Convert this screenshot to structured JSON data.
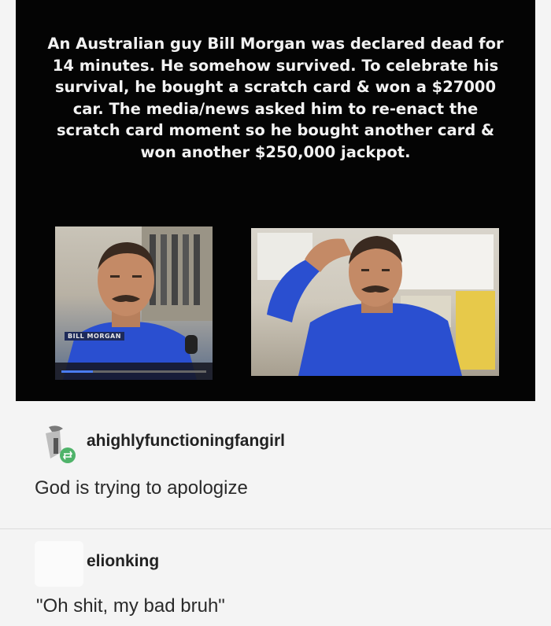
{
  "meme": {
    "caption": "An Australian guy Bill Morgan was declared dead for 14 minutes. He somehow survived. To celebrate his survival, he bought a scratch card & won a $27000 car. The media/news asked him to re-enact the scratch card moment so he bought another card & won another $250,000 jackpot.",
    "left_photo": {
      "lower_third": "BILL MORGAN",
      "video_progress": 0.22
    },
    "colors": {
      "shirt": "#2a4fd0",
      "background": "#040404"
    }
  },
  "post": {
    "reblogs": [
      {
        "username": "ahighlyfunctioningfangirl",
        "comment": "God is trying to apologize",
        "avatar_icon": "reblog-avatar-icon"
      },
      {
        "username": "elionking",
        "comment": "\"Oh shit, my bad bruh\"",
        "avatar_icon": "blank-avatar"
      }
    ]
  }
}
